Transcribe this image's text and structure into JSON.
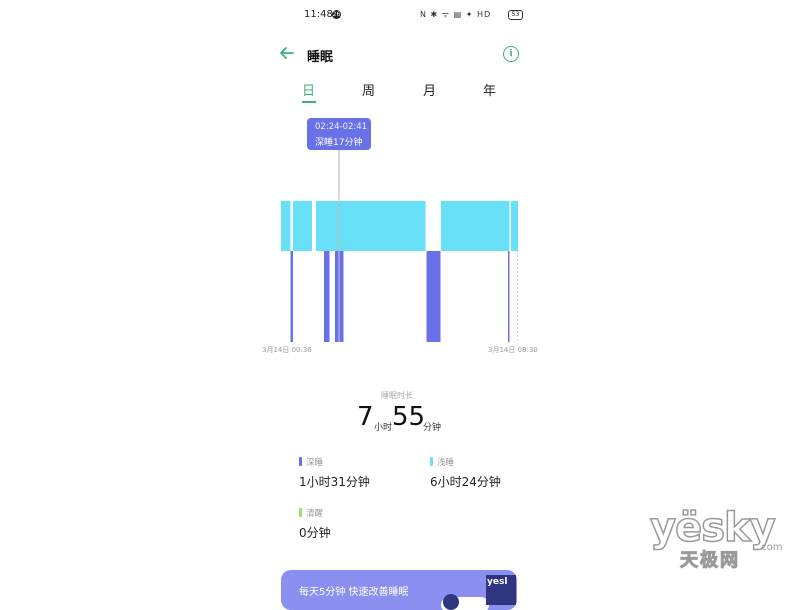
{
  "status_bar": {
    "time": "11:48",
    "notification_count": "26",
    "icons_text": "N ✱ ᯤ ▤ ✦ HD",
    "battery": "53"
  },
  "header": {
    "title": "睡眠",
    "back_icon": "back-arrow-icon",
    "info_icon": "info-icon",
    "info_glyph": "i",
    "accent_color": "#3bb27a"
  },
  "tabs": [
    {
      "label": "日",
      "active": true
    },
    {
      "label": "周",
      "active": false
    },
    {
      "label": "月",
      "active": false
    },
    {
      "label": "年",
      "active": false
    }
  ],
  "tooltip": {
    "time_range": "02:24-02:41",
    "text": "深睡17分钟"
  },
  "chart_data": {
    "type": "bar",
    "x_start_label": "3月14日 00:36",
    "x_end_label": "3月14日 08:30",
    "start_minutes": 36,
    "end_minutes": 510,
    "light_color": "#67e0f8",
    "deep_color": "#6871e8",
    "light_segments": [
      [
        36,
        55
      ],
      [
        60,
        98
      ],
      [
        106,
        325
      ],
      [
        356,
        493
      ],
      [
        496,
        510
      ]
    ],
    "deep_segments": [
      [
        55,
        60
      ],
      [
        122,
        133
      ],
      [
        144,
        161
      ],
      [
        327,
        355
      ],
      [
        490,
        493
      ]
    ],
    "selected_minute": 152
  },
  "summary": {
    "duration_label": "睡眠时长",
    "hours": "7",
    "hours_unit": "小时",
    "minutes": "55",
    "minutes_unit": "分钟"
  },
  "legend": {
    "deep": {
      "name": "深睡",
      "value": "1小时31分钟",
      "color": "#6871e8"
    },
    "light": {
      "name": "浅睡",
      "value": "6小时24分钟",
      "color": "#67e0f8"
    },
    "awake": {
      "name": "清醒",
      "value": "0分钟",
      "color": "#9be45a"
    }
  },
  "promo": {
    "text": "每天5分钟 快速改善睡眠",
    "thumb_text": "yesl",
    "bg_color": "#8b8ff0"
  },
  "watermark": {
    "main": "yësky",
    "sub": "天极网",
    "suffix": ".com"
  }
}
